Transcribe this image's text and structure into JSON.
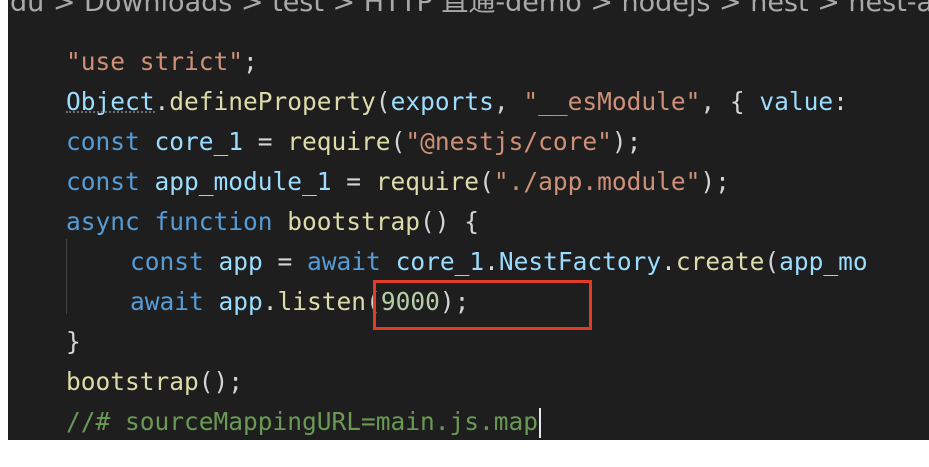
{
  "breadcrumb": "du > Downloads > test > HTTP 直通-demo > nodejs > nest > nest-ap",
  "code": {
    "l1": "\"use strict\"",
    "l1_semi": ";",
    "l2_obj": "Object",
    "l2_dot": ".",
    "l2_fn": "defineProperty",
    "l2_open": "(",
    "l2_exports": "exports",
    "l2_comma": ", ",
    "l2_str": "\"__esModule\"",
    "l2_rest": ", { ",
    "l2_value": "value",
    "l2_colon": ":",
    "l3_const": "const",
    "l3_var": " core_1 ",
    "l3_eq": "= ",
    "l3_fn": "require",
    "l3_open": "(",
    "l3_str": "\"@nestjs/core\"",
    "l3_close": ");",
    "l4_const": "const",
    "l4_var": " app_module_1 ",
    "l4_eq": "= ",
    "l4_fn": "require",
    "l4_open": "(",
    "l4_str": "\"./app.module\"",
    "l4_close": ");",
    "l5_async": "async",
    "l5_function": " function",
    "l5_fn": " bootstrap",
    "l5_rest": "() {",
    "l6_const": "const",
    "l6_var": " app ",
    "l6_eq": "= ",
    "l6_await": "await",
    "l6_obj": " core_1",
    "l6_dot": ".",
    "l6_cls": "NestFactory",
    "l6_dot2": ".",
    "l6_fn": "create",
    "l6_open": "(",
    "l6_arg": "app_mo",
    "l7_await": "await",
    "l7_obj": " app",
    "l7_dot": ".",
    "l7_fn": "listen",
    "l7_open": "(",
    "l7_num": "9000",
    "l7_close": ");",
    "l8": "}",
    "l9_fn": "bootstrap",
    "l9_rest": "();",
    "l10": "//# sourceMappingURL=main.js.map"
  }
}
